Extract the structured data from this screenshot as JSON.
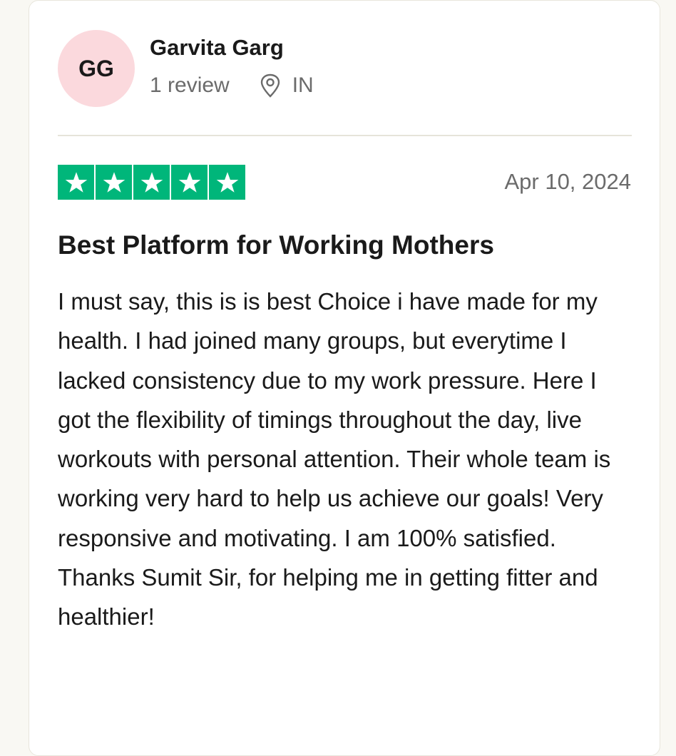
{
  "reviewer": {
    "initials": "GG",
    "name": "Garvita Garg",
    "review_count": "1 review",
    "location": "IN",
    "avatar_color": "#fbd9dd"
  },
  "review": {
    "rating": 5,
    "rating_max": 5,
    "star_color": "#00b67a",
    "date": "Apr 10, 2024",
    "title": "Best Platform for Working Mothers",
    "body": "I must say, this is is best Choice i have made for my health. I had joined many groups, but everytime I lacked consistency due to my work pressure. Here I got the flexibility of timings throughout the day, live workouts with personal attention. Their whole team is working very hard to help us achieve our goals! Very responsive and motivating. I am 100% satisfied. Thanks Sumit Sir, for helping me in getting fitter and healthier!"
  },
  "icons": {
    "location": "map-pin-icon",
    "star": "star-icon"
  }
}
